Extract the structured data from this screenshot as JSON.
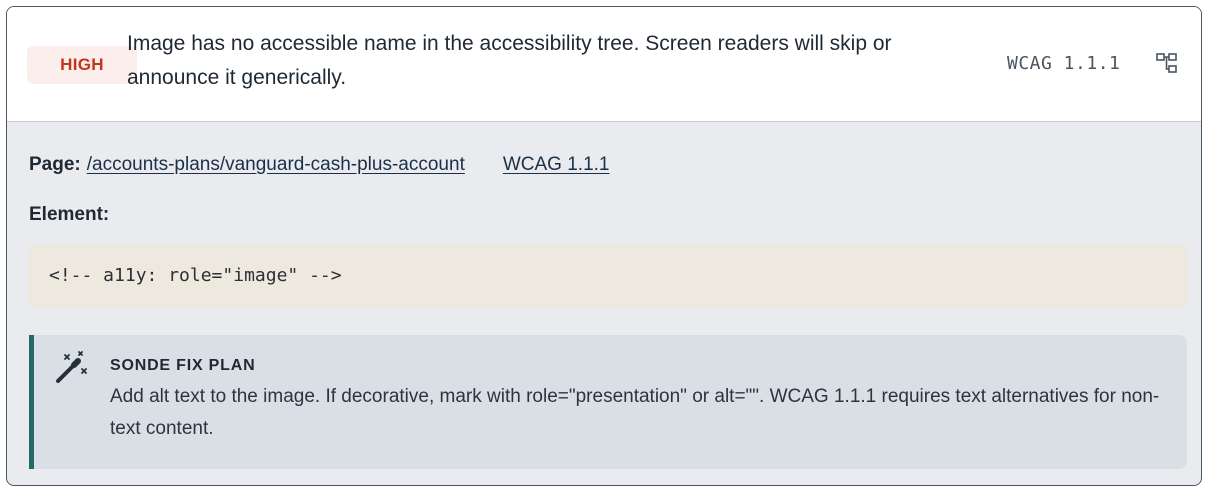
{
  "issue": {
    "severity": "HIGH",
    "summary": "Image has no accessible name in the accessibility tree. Screen readers will skip or announce it generically.",
    "wcag_tag": "WCAG 1.1.1",
    "tree_icon": "hierarchy-icon"
  },
  "details": {
    "page_label": "Page:",
    "page_path": "/accounts-plans/vanguard-cash-plus-account",
    "wcag_link": "WCAG 1.1.1",
    "element_label": "Element:",
    "element_code": "<!-- a11y: role=\"image\" -->"
  },
  "fix": {
    "icon": "magic-wand-icon",
    "title": "SONDE FIX PLAN",
    "text": "Add alt text to the image. If decorative, mark with role=\"presentation\" or alt=\"\". WCAG 1.1.1 requires text alternatives for non-text content."
  },
  "colors": {
    "severity_text": "#c2361a",
    "severity_bg": "#fdeeee",
    "fix_accent": "#206b68",
    "link": "#1c2f4a"
  }
}
